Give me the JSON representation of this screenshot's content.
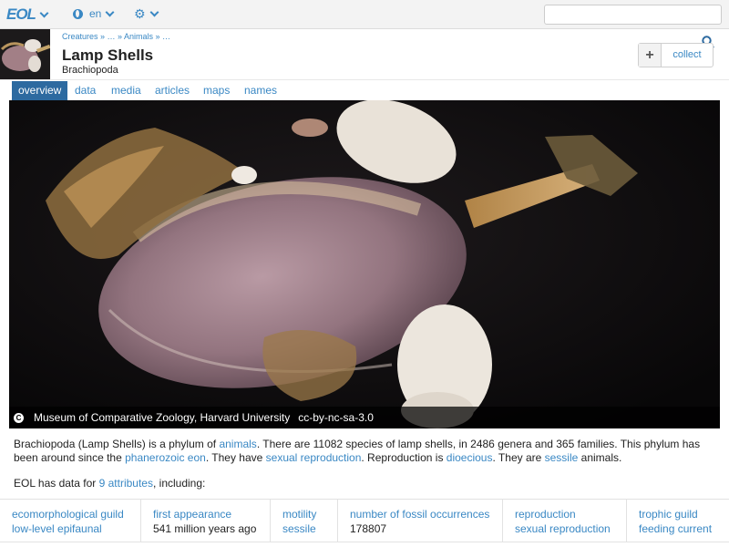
{
  "topbar": {
    "logo": "EOL",
    "language": "en",
    "search_placeholder": ""
  },
  "header": {
    "breadcrumbs": "Creatures » … » Animals » …",
    "title": "Lamp Shells",
    "subtitle": "Brachiopoda",
    "collect_label": "collect",
    "collect_plus": "+"
  },
  "tabs": [
    "overview",
    "data",
    "media",
    "articles",
    "maps",
    "names"
  ],
  "hero": {
    "attribution": "Museum of Comparative Zoology, Harvard University",
    "license": "cc-by-nc-sa-3.0",
    "cc_glyph": "C"
  },
  "summary": {
    "p1": "Brachiopoda (Lamp Shells) is a phylum of ",
    "l1": "animals",
    "p2": ". There are 11082 species of lamp shells, in 2486 genera and 365 families. This phylum has been around since the ",
    "l2": "phanerozoic eon",
    "p3": ". They have ",
    "l3": "sexual reproduction",
    "p4": ". Reproduction is ",
    "l4": "dioecious",
    "p5": ". They are ",
    "l5": "sessile",
    "p6": " animals."
  },
  "data_count": {
    "prefix": "EOL has data for ",
    "link": "9 attributes",
    "suffix": ", including:"
  },
  "attributes": [
    {
      "key": "ecomorphological guild",
      "value": "low-level epifaunal",
      "value_is_link": true
    },
    {
      "key": "first appearance",
      "value": "541 million years ago",
      "value_is_link": false
    },
    {
      "key": "motility",
      "value": "sessile",
      "value_is_link": true
    },
    {
      "key": "number of fossil occurrences",
      "value": "178807",
      "value_is_link": false
    },
    {
      "key": "reproduction",
      "value": "sexual reproduction",
      "value_is_link": true
    },
    {
      "key": "trophic guild",
      "value": "feeding current",
      "value_is_link": true
    }
  ],
  "colors": {
    "link": "#3a88c4",
    "active_tab": "#2d6aa0"
  }
}
